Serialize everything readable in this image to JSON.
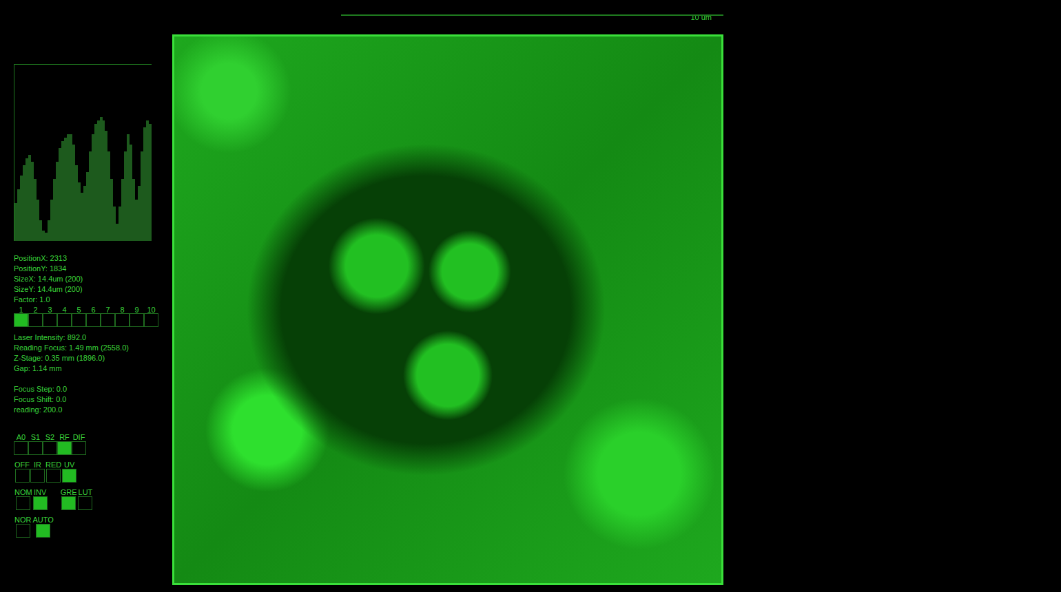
{
  "scale_bar": {
    "label": "10 um"
  },
  "histogram": {
    "values": [
      55,
      75,
      95,
      110,
      120,
      125,
      115,
      90,
      60,
      30,
      15,
      12,
      30,
      60,
      90,
      115,
      135,
      145,
      150,
      155,
      155,
      140,
      110,
      85,
      70,
      80,
      100,
      130,
      155,
      170,
      175,
      180,
      175,
      160,
      130,
      90,
      50,
      25,
      50,
      90,
      130,
      155,
      140,
      90,
      60,
      80,
      130,
      165,
      175,
      170
    ]
  },
  "info_top": [
    "PositionX: 2313",
    "PositionY: 1834",
    "SizeX: 14.4um (200)",
    "SizeY: 14.4um (200)",
    "Factor: 1.0"
  ],
  "slots": [
    {
      "label": "1",
      "selected": true
    },
    {
      "label": "2",
      "selected": false
    },
    {
      "label": "3",
      "selected": false
    },
    {
      "label": "4",
      "selected": false
    },
    {
      "label": "5",
      "selected": false
    },
    {
      "label": "6",
      "selected": false
    },
    {
      "label": "7",
      "selected": false
    },
    {
      "label": "8",
      "selected": false
    },
    {
      "label": "9",
      "selected": false
    },
    {
      "label": "10",
      "selected": false
    }
  ],
  "info_mid": [
    "Laser Intensity: 892.0",
    "Reading Focus: 1.49 mm (2558.0)",
    "Z-Stage: 0.35 mm (1896.0)",
    "Gap: 1.14 mm"
  ],
  "info_bottom": [
    "Focus Step: 0.0",
    "Focus Shift: 0.0",
    "reading: 200.0"
  ],
  "toggle_rows": [
    {
      "groups": [
        {
          "options": [
            {
              "label": "A0",
              "selected": false
            },
            {
              "label": "S1",
              "selected": false
            },
            {
              "label": "S2",
              "selected": false
            },
            {
              "label": "RF",
              "selected": true
            },
            {
              "label": "DIF",
              "selected": false
            }
          ]
        }
      ]
    },
    {
      "groups": [
        {
          "options": [
            {
              "label": "OFF",
              "selected": false
            },
            {
              "label": "IR",
              "selected": false
            },
            {
              "label": "RED",
              "selected": false
            },
            {
              "label": "UV",
              "selected": true
            }
          ]
        }
      ]
    },
    {
      "groups": [
        {
          "options": [
            {
              "label": "NOM",
              "selected": false
            },
            {
              "label": "INV",
              "selected": true
            }
          ]
        },
        {
          "options": [
            {
              "label": "GRE",
              "selected": true
            },
            {
              "label": "LUT",
              "selected": false
            }
          ]
        }
      ]
    },
    {
      "groups": [
        {
          "options": [
            {
              "label": "NOR",
              "selected": false
            },
            {
              "label": "AUTO",
              "selected": true
            }
          ]
        }
      ]
    }
  ]
}
